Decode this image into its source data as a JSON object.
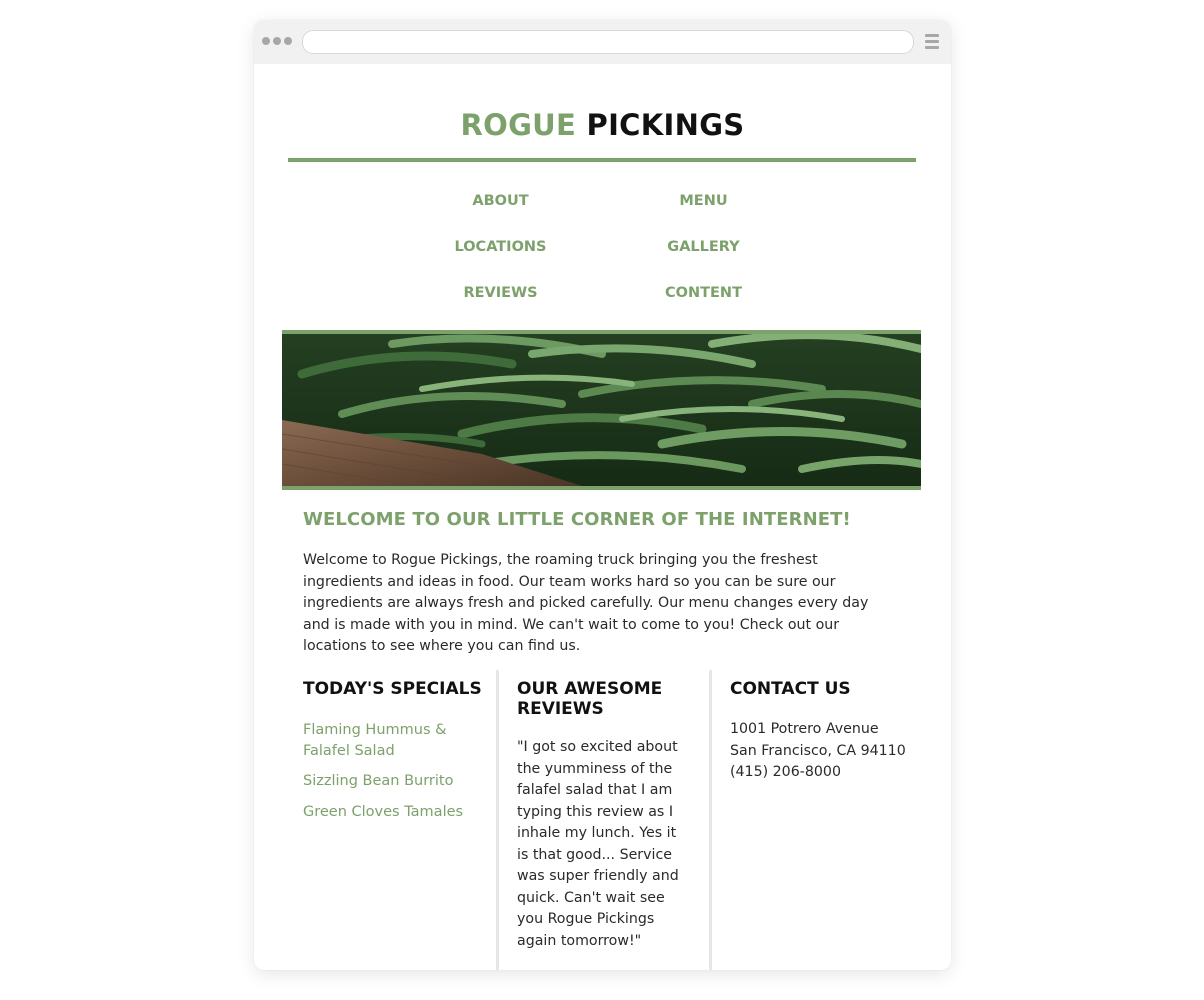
{
  "site": {
    "logo_part1": "ROGUE",
    "logo_part2": " PICKINGS"
  },
  "nav": {
    "items": [
      {
        "label": "ABOUT"
      },
      {
        "label": "MENU"
      },
      {
        "label": "LOCATIONS"
      },
      {
        "label": "GALLERY"
      },
      {
        "label": "REVIEWS"
      },
      {
        "label": "CONTENT"
      }
    ]
  },
  "welcome": {
    "title": "WELCOME TO OUR LITTLE CORNER OF THE INTERNET!",
    "text": "Welcome to Rogue Pickings, the roaming truck bringing you the freshest ingredients and ideas in food. Our team works hard so you can be sure our ingredients are always fresh and picked carefully. Our menu changes every day and is made with you in mind. We can't wait to come to you! Check out our locations to see where you can find us."
  },
  "specials": {
    "title": "TODAY'S SPECIALS",
    "items": [
      "Flaming Hummus & Falafel Salad",
      "Sizzling Bean Burrito",
      "Green Cloves Tamales"
    ]
  },
  "reviews": {
    "title": "OUR AWESOME REVIEWS",
    "text": "\"I got so excited about the yumminess of the falafel salad that I am typing this review as I inhale my lunch. Yes it is that good... Service was super friendly and quick. Can't wait see you Rogue Pickings again tomorrow!\""
  },
  "contact": {
    "title": "CONTACT US",
    "address_line1": "1001 Potrero Avenue",
    "address_line2": "San Francisco, CA 94110",
    "phone": "(415) 206-8000"
  },
  "theme": {
    "accent": "#7da16b",
    "text": "#2a2a2a",
    "heading": "#111111"
  },
  "icons": {
    "window_dots": "window-dots-icon",
    "menu": "hamburger-menu-icon"
  }
}
